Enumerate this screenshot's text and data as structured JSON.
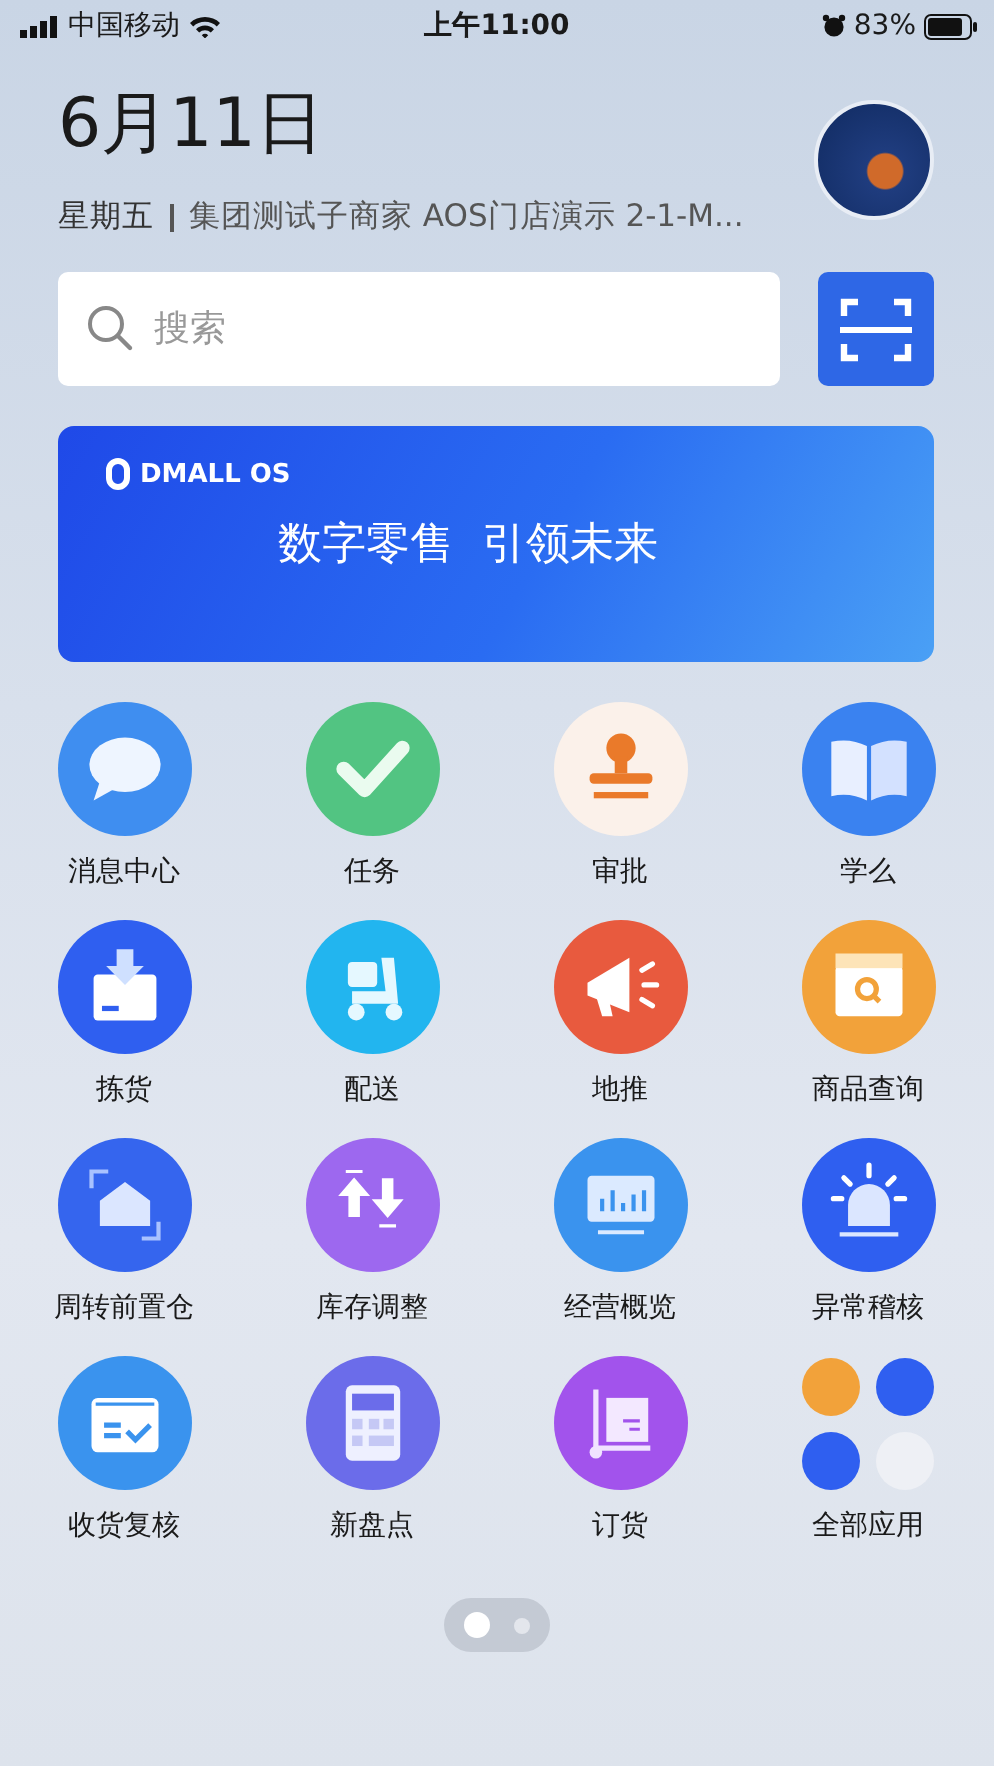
{
  "status_bar": {
    "carrier": "中国移动",
    "time": "上午11:00",
    "battery": "83%"
  },
  "header": {
    "date": "6月11日",
    "weekday": "星期五",
    "store": "集团测试子商家 AOS门店演示 2-1-M..."
  },
  "search": {
    "placeholder": "搜索"
  },
  "banner": {
    "logo": "DMALL OS",
    "slogan": "数字零售  引领未来"
  },
  "apps": [
    {
      "label": "消息中心",
      "kind": "chat",
      "color": "#3f8ef0"
    },
    {
      "label": "任务",
      "kind": "check",
      "color": "#52c482"
    },
    {
      "label": "审批",
      "kind": "stamp",
      "color": "#fbf1ea"
    },
    {
      "label": "学么",
      "kind": "book",
      "color": "#3a82f0"
    },
    {
      "label": "拣货",
      "kind": "box",
      "color": "#2f5ff0"
    },
    {
      "label": "配送",
      "kind": "scooter",
      "color": "#22b5ef"
    },
    {
      "label": "地推",
      "kind": "megaphone",
      "color": "#e85a3e"
    },
    {
      "label": "商品查询",
      "kind": "searchbox",
      "color": "#f2a23a"
    },
    {
      "label": "周转前置仓",
      "kind": "warehouse",
      "color": "#3565ee"
    },
    {
      "label": "库存调整",
      "kind": "arrows",
      "color": "#9d68ef"
    },
    {
      "label": "经营概览",
      "kind": "chart",
      "color": "#3a93ee"
    },
    {
      "label": "异常稽核",
      "kind": "siren",
      "color": "#2f5ff0"
    },
    {
      "label": "收货复核",
      "kind": "receipt",
      "color": "#3a93ee"
    },
    {
      "label": "新盘点",
      "kind": "calculator",
      "color": "#6b6cea"
    },
    {
      "label": "订货",
      "kind": "cart",
      "color": "#a253ec"
    },
    {
      "label": "全部应用",
      "kind": "folder",
      "minis": [
        {
          "color": "#f2a23a"
        },
        {
          "color": "#2f5ff0"
        },
        {
          "color": "#2f5ff0"
        },
        {
          "color": "#eef0f5"
        }
      ]
    }
  ],
  "pages": [
    {
      "selected": true
    },
    {
      "selected": false
    }
  ]
}
